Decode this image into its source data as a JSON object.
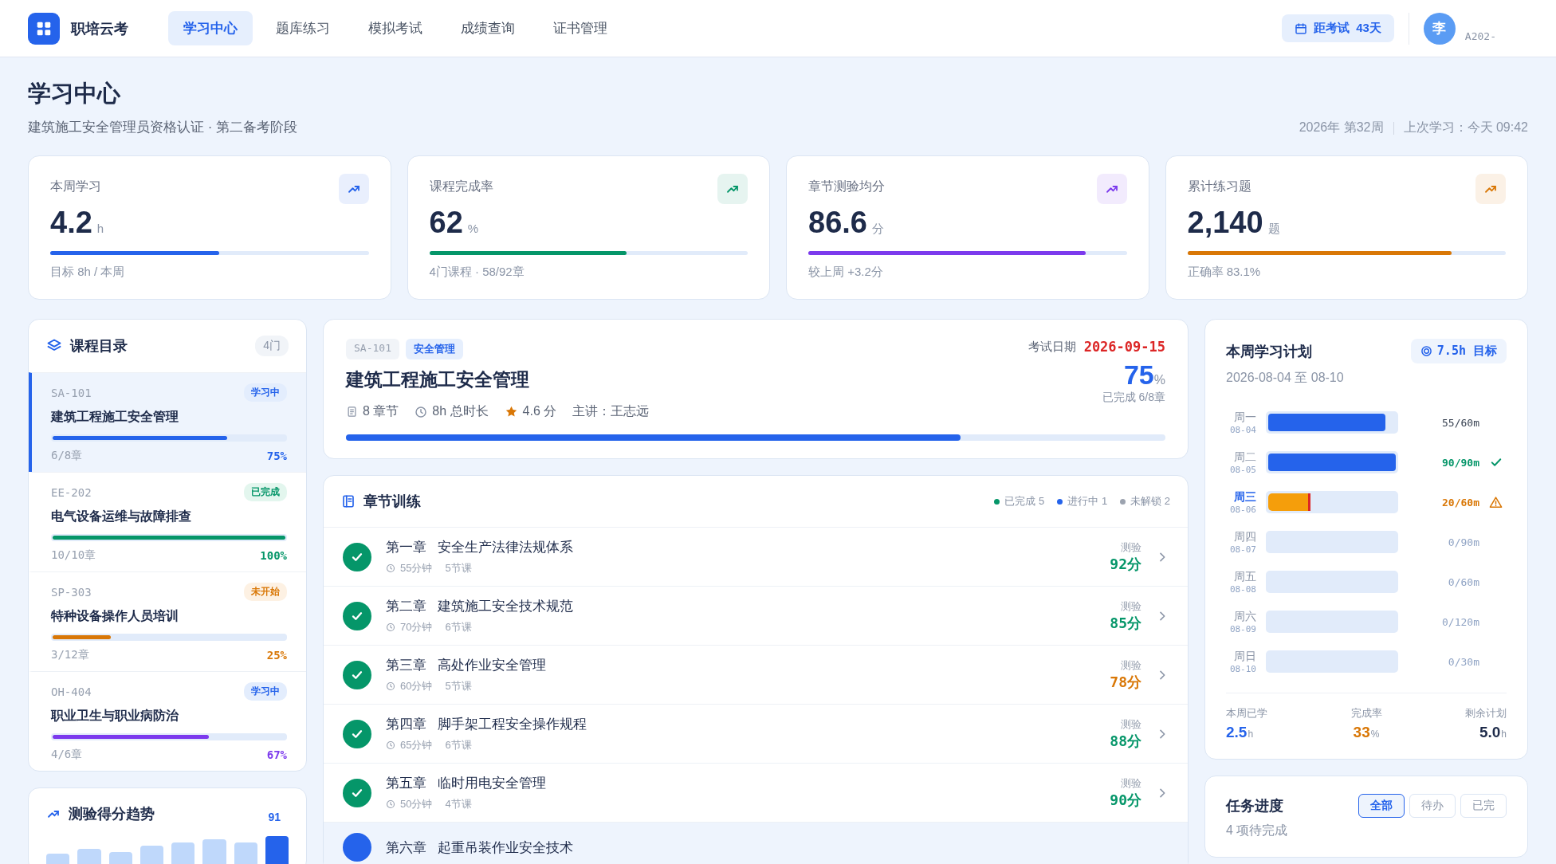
{
  "app": {
    "logo_text": "职培云考",
    "nav": [
      {
        "label": "学习中心",
        "selected": true
      },
      {
        "label": "题库练习",
        "selected": false
      },
      {
        "label": "模拟考试",
        "selected": false
      },
      {
        "label": "成绩查询",
        "selected": false
      },
      {
        "label": "证书管理",
        "selected": false
      }
    ],
    "countdown": "距考试  43天",
    "avatar": "李",
    "user_id": "A202-"
  },
  "page": {
    "title": "学习中心",
    "subtitle": "建筑施工安全管理员资格认证 · 第二备考阶段",
    "week": "2026年 第32周",
    "last_study": "上次学习：今天 09:42"
  },
  "stats": [
    {
      "label": "本周学习",
      "value": "4.2",
      "unit": "h",
      "level": 0.53,
      "note": "目标 8h / 本周",
      "color": "#2563eb"
    },
    {
      "label": "课程完成率",
      "value": "62",
      "unit": "%",
      "level": 0.62,
      "note": "4门课程 · 58/92章",
      "color": "#059669"
    },
    {
      "label": "章节测验均分",
      "value": "86.6",
      "unit": "分",
      "level": 0.87,
      "note": "较上周 +3.2分",
      "color": "#7c3aed"
    },
    {
      "label": "累计练习题",
      "value": "2,140",
      "unit": "题",
      "level": 0.83,
      "note": "正确率 83.1%",
      "color": "#d97706"
    }
  ],
  "courses": {
    "title": "课程目录",
    "count": "4门",
    "items": [
      {
        "code": "SA-101",
        "badge": "学习中",
        "kind": "learning",
        "title": "建筑工程施工安全管理",
        "progress": "6/8章",
        "percent": "75%",
        "level": 0.75,
        "color": "#2563eb",
        "selected": true
      },
      {
        "code": "EE-202",
        "badge": "已完成",
        "kind": "done",
        "title": "电气设备运维与故障排查",
        "progress": "10/10章",
        "percent": "100%",
        "level": 1.0,
        "color": "#059669",
        "selected": false
      },
      {
        "code": "SP-303",
        "badge": "未开始",
        "kind": "pending",
        "title": "特种设备操作人员培训",
        "progress": "3/12章",
        "percent": "25%",
        "level": 0.25,
        "color": "#d97706",
        "selected": false
      },
      {
        "code": "OH-404",
        "badge": "学习中",
        "kind": "learning",
        "title": "职业卫生与职业病防治",
        "progress": "4/6章",
        "percent": "67%",
        "level": 0.67,
        "color": "#7c3aed",
        "selected": false
      }
    ]
  },
  "trend": {
    "title": "测验得分趋势",
    "last_value": "91"
  },
  "detail": {
    "code": "SA-101",
    "category": "安全管理",
    "title": "建筑工程施工安全管理",
    "chapters": "8 章节",
    "duration": "8h 总时长",
    "rating": "4.6 分",
    "teacher": "主讲：王志远",
    "exam_label": "考试日期",
    "exam_date": "2026-09-15",
    "percent": "75",
    "percent_unit": "%",
    "done_note": "已完成 6/8章",
    "level": 0.75
  },
  "chapters": {
    "title": "章节训练",
    "legend": [
      {
        "label": "已完成 5",
        "color": "#059669"
      },
      {
        "label": "进行中 1",
        "color": "#2563eb"
      },
      {
        "label": "未解锁 2",
        "color": "#9ca3af"
      }
    ],
    "items": [
      {
        "number": "第一章",
        "title": "安全生产法律法规体系",
        "minutes": "55分钟",
        "lessons": "5节课",
        "score_label": "测验",
        "score": "92分",
        "color": "#059669",
        "kind": "done",
        "selected": false
      },
      {
        "number": "第二章",
        "title": "建筑施工安全技术规范",
        "minutes": "70分钟",
        "lessons": "6节课",
        "score_label": "测验",
        "score": "85分",
        "color": "#059669",
        "kind": "done",
        "selected": false
      },
      {
        "number": "第三章",
        "title": "高处作业安全管理",
        "minutes": "60分钟",
        "lessons": "5节课",
        "score_label": "测验",
        "score": "78分",
        "color": "#d97706",
        "kind": "done",
        "selected": false
      },
      {
        "number": "第四章",
        "title": "脚手架工程安全操作规程",
        "minutes": "65分钟",
        "lessons": "6节课",
        "score_label": "测验",
        "score": "88分",
        "color": "#059669",
        "kind": "done",
        "selected": false
      },
      {
        "number": "第五章",
        "title": "临时用电安全管理",
        "minutes": "50分钟",
        "lessons": "4节课",
        "score_label": "测验",
        "score": "90分",
        "color": "#059669",
        "kind": "done",
        "selected": false
      },
      {
        "number": "第六章",
        "title": "起重吊装作业安全技术",
        "kind": "active",
        "selected": true
      }
    ]
  },
  "plan": {
    "title": "本周学习计划",
    "goal": "7.5h 目标",
    "range": "2026-08-04 至 08-10",
    "days": [
      {
        "day": "周一",
        "date": "08-04",
        "level": 0.917,
        "reading": "55/60m",
        "kind": "partial",
        "selected": false
      },
      {
        "day": "周二",
        "date": "08-05",
        "level": 1.0,
        "reading": "90/90m",
        "kind": "done",
        "selected": false
      },
      {
        "day": "周三",
        "date": "08-06",
        "level": 0.333,
        "reading": "20/60m",
        "kind": "behind",
        "selected": true
      },
      {
        "day": "周四",
        "date": "08-07",
        "reading": "0/90m",
        "kind": "upcoming",
        "selected": false
      },
      {
        "day": "周五",
        "date": "08-08",
        "reading": "0/60m",
        "kind": "upcoming",
        "selected": false
      },
      {
        "day": "周六",
        "date": "08-09",
        "reading": "0/120m",
        "kind": "upcoming",
        "selected": false
      },
      {
        "day": "周日",
        "date": "08-10",
        "reading": "0/30m",
        "kind": "upcoming",
        "selected": false
      }
    ],
    "summary": [
      {
        "label": "本周已学",
        "value": "2.5",
        "unit": "h",
        "color": "#2563eb"
      },
      {
        "label": "完成率",
        "value": "33",
        "unit": "%",
        "color": "#d97706"
      },
      {
        "label": "剩余计划",
        "value": "5.0",
        "unit": "h",
        "color": "#1e2b4a"
      }
    ]
  },
  "tasks": {
    "title": "任务进度",
    "subtitle": "4 项待完成",
    "filters": [
      {
        "label": "全部",
        "selected": true
      },
      {
        "label": "待办",
        "selected": false
      },
      {
        "label": "已完",
        "selected": false
      }
    ]
  }
}
